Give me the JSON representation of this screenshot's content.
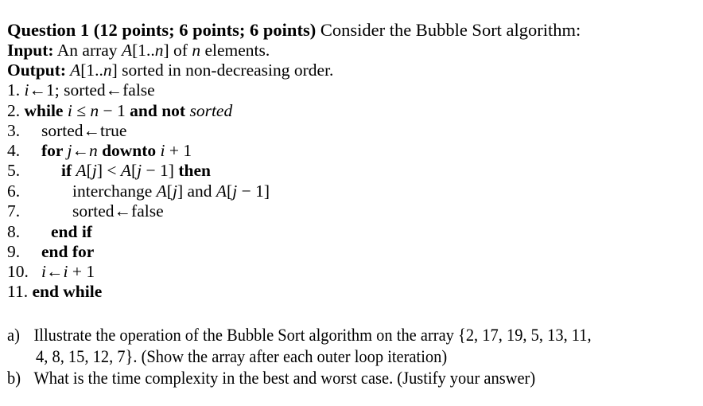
{
  "question": {
    "title_bold": "Question 1 (12 points; 6 points; 6 points)",
    "title_rest": " Consider the Bubble Sort algorithm:",
    "input_label": "Input:",
    "input_pre": " An array ",
    "input_A": "A",
    "input_range_pre": "[1..",
    "input_n": "n",
    "input_range_post": "] of ",
    "input_n2": "n",
    "input_post": " elements.",
    "output_label": "Output:",
    "output_A": " A",
    "output_range_pre": "[1..",
    "output_n": "n",
    "output_post": "] sorted in non-decreasing order."
  },
  "algorithm": {
    "l1": {
      "num": "1. ",
      "i": "i",
      "rest": "←1; sorted←false"
    },
    "l2": {
      "num": "2. ",
      "kw1": "while ",
      "i": "i",
      "mid": " ≤ ",
      "n": "n",
      "minus": " − 1 ",
      "kw2": "and not ",
      "sorted": "sorted"
    },
    "l3": {
      "num": "3.",
      "text": "sorted←true"
    },
    "l4": {
      "num": "4.",
      "kw1": "for ",
      "j": "j",
      "arrow": "←",
      "n": "n",
      "kw2": " downto ",
      "i": "i",
      "rest": " + 1"
    },
    "l5": {
      "num": "5.",
      "kw1": "if ",
      "a1": "A",
      "b1": "[",
      "j1": "j",
      "c1": "] < ",
      "a2": "A",
      "b2": "[",
      "j2": "j",
      "c2": " − 1] ",
      "kw2": "then"
    },
    "l6": {
      "num": "6.",
      "pre": "interchange ",
      "a1": "A",
      "b1": "[",
      "j1": "j",
      "c1": "] and ",
      "a2": "A",
      "b2": "[",
      "j2": "j",
      "c2": " − 1]"
    },
    "l7": {
      "num": "7.",
      "text": "sorted←false"
    },
    "l8": {
      "num": "8.",
      "kw": "end if"
    },
    "l9": {
      "num": "9.",
      "kw": "end for"
    },
    "l10": {
      "num": "10.",
      "i1": "i",
      "arrow": "←",
      "i2": "i",
      "rest": " + 1"
    },
    "l11": {
      "num": "11. ",
      "kw": "end while"
    }
  },
  "parts": {
    "a_label": "a)",
    "a_line1": "Illustrate the operation of the Bubble Sort algorithm on the array {2, 17, 19, 5, 13, 11,",
    "a_line2": "4, 8, 15, 12, 7}. (Show the array after each outer loop iteration)",
    "b_label": "b)",
    "b_line1": "What is the time complexity in the best and worst case. (Justify your answer)"
  }
}
